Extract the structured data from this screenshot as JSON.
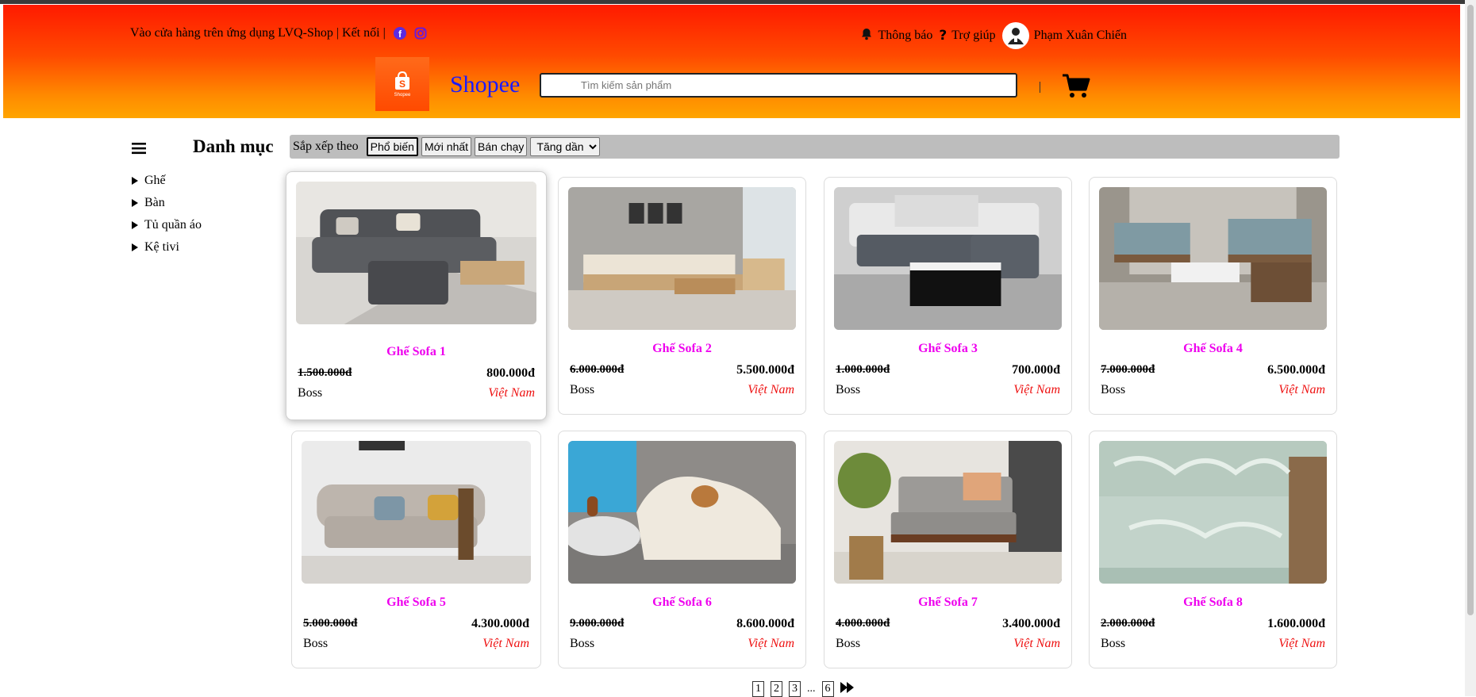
{
  "topbar": {
    "left_text": "Vào cửa hàng trên ứng dụng LVQ-Shop | Kết nối |",
    "notification": "Thông báo",
    "help": "Trợ giúp",
    "user_name": "Phạm Xuân Chiến"
  },
  "brand": {
    "name": "Shopee",
    "logo_label": "Shopee"
  },
  "search": {
    "placeholder": "Tìm kiếm sản phẩm"
  },
  "sidebar": {
    "title": "Danh mục",
    "items": [
      "Ghế",
      "Bàn",
      "Tủ quần áo",
      "Kệ tivi"
    ]
  },
  "sort": {
    "label": "Sắp xếp theo",
    "buttons": [
      "Phổ biến",
      "Mới nhất",
      "Bán chạy"
    ],
    "active": "Phổ biến",
    "order_selected": "Tăng dần"
  },
  "products": [
    {
      "name": "Ghế Sofa 1",
      "old_price": "1.500.000đ",
      "price": "800.000đ",
      "brand": "Boss",
      "origin": "Việt Nam"
    },
    {
      "name": "Ghế Sofa 2",
      "old_price": "6.000.000đ",
      "price": "5.500.000đ",
      "brand": "Boss",
      "origin": "Việt Nam"
    },
    {
      "name": "Ghế Sofa 3",
      "old_price": "1.000.000đ",
      "price": "700.000đ",
      "brand": "Boss",
      "origin": "Việt Nam"
    },
    {
      "name": "Ghế Sofa 4",
      "old_price": "7.000.000đ",
      "price": "6.500.000đ",
      "brand": "Boss",
      "origin": "Việt Nam"
    },
    {
      "name": "Ghế Sofa 5",
      "old_price": "5.000.000đ",
      "price": "4.300.000đ",
      "brand": "Boss",
      "origin": "Việt Nam"
    },
    {
      "name": "Ghế Sofa 6",
      "old_price": "9.000.000đ",
      "price": "8.600.000đ",
      "brand": "Boss",
      "origin": "Việt Nam"
    },
    {
      "name": "Ghế Sofa 7",
      "old_price": "4.000.000đ",
      "price": "3.400.000đ",
      "brand": "Boss",
      "origin": "Việt Nam"
    },
    {
      "name": "Ghế Sofa 8",
      "old_price": "2.000.000đ",
      "price": "1.600.000đ",
      "brand": "Boss",
      "origin": "Việt Nam"
    }
  ],
  "pagination": {
    "pages": [
      "1",
      "2",
      "3",
      "...",
      "6"
    ]
  },
  "icons": {
    "facebook": "facebook-icon",
    "instagram": "instagram-icon",
    "bell": "bell-icon",
    "help": "question-icon",
    "cart": "cart-icon",
    "menu": "hamburger-icon",
    "next": "fast-forward-icon"
  },
  "colors": {
    "header_top": "#ff1a00",
    "header_bottom": "#ffa500",
    "product_name": "#ee00ee",
    "origin": "#ee1111",
    "brand_text": "#1a1aff"
  }
}
